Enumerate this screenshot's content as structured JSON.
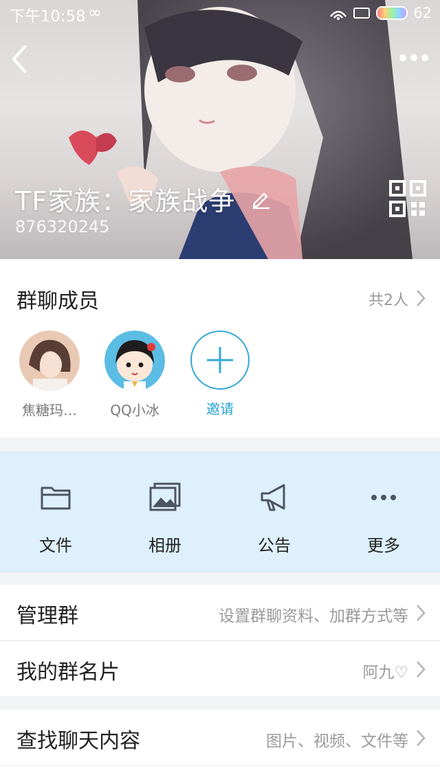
{
  "status_bar": {
    "time": "下午10:58",
    "loop_symbol": "∞",
    "battery": "62"
  },
  "header": {
    "group_name": "TF家族：家族战争",
    "group_id": "876320245"
  },
  "members": {
    "title": "群聊成员",
    "count": "共2人",
    "list": [
      {
        "name": "焦糖玛…"
      },
      {
        "name": "QQ小冰"
      }
    ],
    "invite_label": "邀请"
  },
  "actions": [
    {
      "label": "文件",
      "icon": "folder-icon"
    },
    {
      "label": "相册",
      "icon": "album-icon"
    },
    {
      "label": "公告",
      "icon": "megaphone-icon"
    },
    {
      "label": "更多",
      "icon": "more-dots-icon"
    }
  ],
  "rows": {
    "manage": {
      "title": "管理群",
      "value": "设置群聊资料、加群方式等"
    },
    "card": {
      "title": "我的群名片",
      "value": "阿九♡"
    },
    "search": {
      "title": "查找聊天内容",
      "value": "图片、视频、文件等"
    }
  },
  "colors": {
    "accent": "#2aa2d4",
    "action_bg": "#def0fb"
  }
}
